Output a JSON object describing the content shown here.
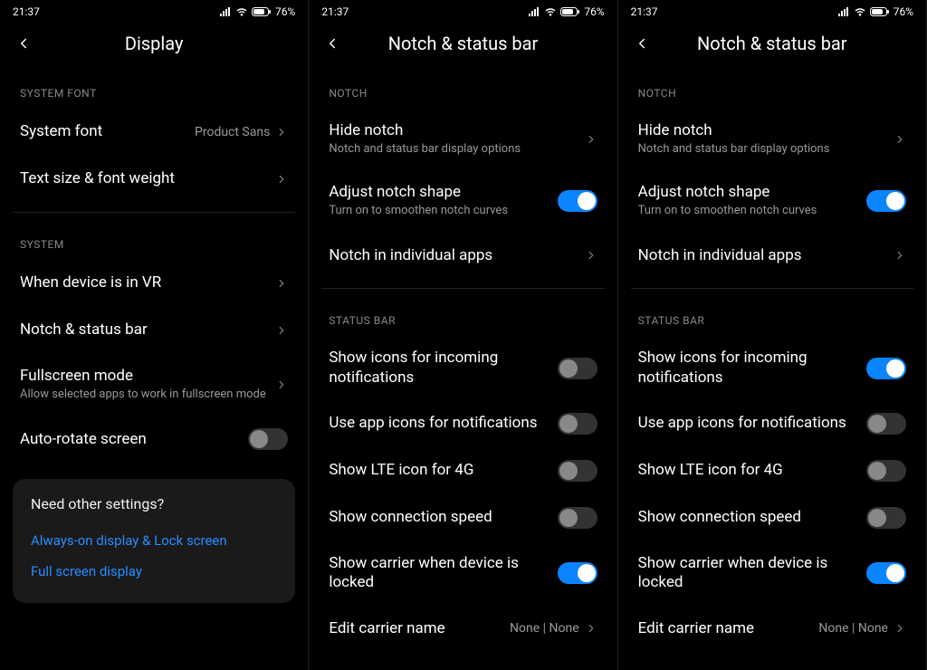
{
  "status": {
    "time": "21:37",
    "battery": "76%"
  },
  "screens": [
    {
      "title": "Display",
      "sections": {
        "font_header": "SYSTEM FONT",
        "system_font_label": "System font",
        "system_font_value": "Product Sans",
        "text_size_label": "Text size & font weight",
        "system_header": "SYSTEM",
        "vr_label": "When device is in VR",
        "notch_label": "Notch & status bar",
        "fullscreen_label": "Fullscreen mode",
        "fullscreen_sub": "Allow selected apps to work in fullscreen mode",
        "autorotate_label": "Auto-rotate screen"
      },
      "card": {
        "title": "Need other settings?",
        "link1": "Always-on display & Lock screen",
        "link2": "Full screen display"
      }
    },
    {
      "title": "Notch & status bar",
      "notch_header": "NOTCH",
      "hide_notch_label": "Hide notch",
      "hide_notch_sub": "Notch and status bar display options",
      "adjust_notch_label": "Adjust notch shape",
      "adjust_notch_sub": "Turn on to smoothen notch curves",
      "indiv_label": "Notch in individual apps",
      "statusbar_header": "STATUS BAR",
      "show_icons_label": "Show icons for incoming notifications",
      "app_icons_label": "Use app icons for notifications",
      "lte_label": "Show LTE icon for 4G",
      "speed_label": "Show connection speed",
      "carrier_label": "Show carrier when device is locked",
      "edit_carrier_label": "Edit carrier name",
      "edit_carrier_value": "None | None",
      "toggles": {
        "adjust": true,
        "show_icons": false,
        "app_icons": false,
        "lte": false,
        "speed": false,
        "carrier": true
      }
    },
    {
      "title": "Notch & status bar",
      "notch_header": "NOTCH",
      "hide_notch_label": "Hide notch",
      "hide_notch_sub": "Notch and status bar display options",
      "adjust_notch_label": "Adjust notch shape",
      "adjust_notch_sub": "Turn on to smoothen notch curves",
      "indiv_label": "Notch in individual apps",
      "statusbar_header": "STATUS BAR",
      "show_icons_label": "Show icons for incoming notifications",
      "app_icons_label": "Use app icons for notifications",
      "lte_label": "Show LTE icon for 4G",
      "speed_label": "Show connection speed",
      "carrier_label": "Show carrier when device is locked",
      "edit_carrier_label": "Edit carrier name",
      "edit_carrier_value": "None | None",
      "toggles": {
        "adjust": true,
        "show_icons": true,
        "app_icons": false,
        "lte": false,
        "speed": false,
        "carrier": true
      }
    }
  ]
}
